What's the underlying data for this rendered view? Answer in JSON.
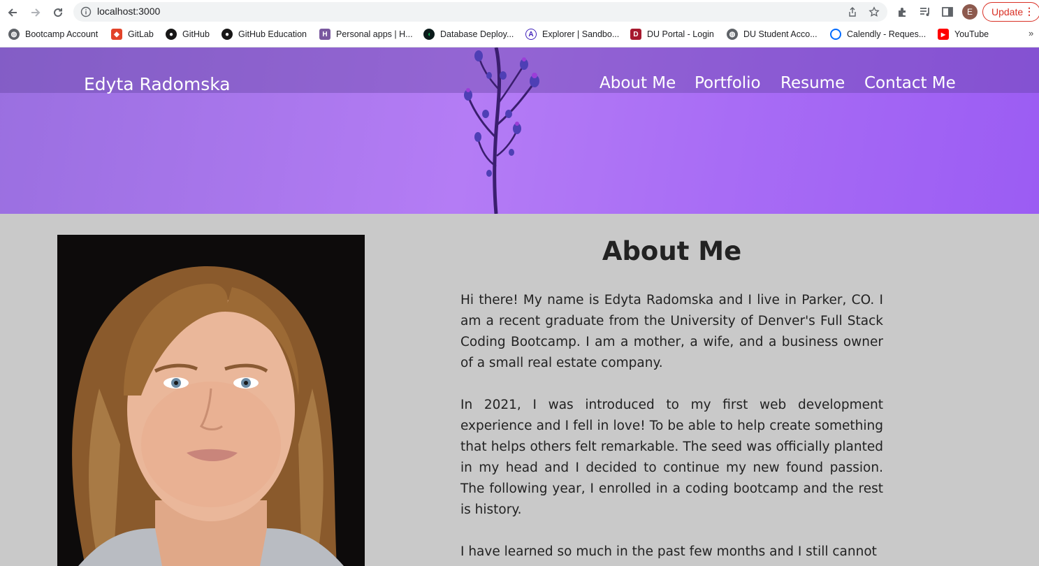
{
  "browser": {
    "url": "localhost:3000",
    "avatar_letter": "E",
    "update_label": "Update",
    "menu_glyph": "⋮",
    "more_glyph": "»",
    "bookmarks": [
      {
        "label": "Bootcamp Account",
        "icon": "globe-icon",
        "color": "#5f6368"
      },
      {
        "label": "GitLab",
        "icon": "gitlab-icon",
        "color": "#e24329"
      },
      {
        "label": "GitHub",
        "icon": "github-icon",
        "color": "#181717"
      },
      {
        "label": "GitHub Education",
        "icon": "github-icon",
        "color": "#181717"
      },
      {
        "label": "Personal apps | H...",
        "icon": "heroku-icon",
        "color": "#79589f"
      },
      {
        "label": "Database Deploy...",
        "icon": "mongodb-icon",
        "color": "#13aa52"
      },
      {
        "label": "Explorer | Sandbo...",
        "icon": "apollo-icon",
        "color": "#3f20ba"
      },
      {
        "label": "DU Portal - Login",
        "icon": "du-icon",
        "color": "#a6192e"
      },
      {
        "label": "DU Student Acco...",
        "icon": "globe-icon",
        "color": "#5f6368"
      },
      {
        "label": "Calendly - Reques...",
        "icon": "calendly-icon",
        "color": "#006bff"
      },
      {
        "label": "YouTube",
        "icon": "youtube-icon",
        "color": "#ff0000"
      }
    ]
  },
  "site": {
    "brand": "Edyta Radomska",
    "nav": [
      "About Me",
      "Portfolio",
      "Resume",
      "Contact Me"
    ]
  },
  "about": {
    "title": "About Me",
    "paragraphs": [
      "Hi there! My name is Edyta Radomska and I live in Parker, CO. I am a recent graduate from the University of Denver's Full Stack Coding Bootcamp. I am a mother, a wife, and a business owner of a small real estate company.",
      "In 2021, I was introduced to my first web development experience and I fell in love! To be able to help create something that helps others felt remarkable. The seed was officially planted in my head and I decided to continue my new found passion. The following year, I enrolled in a coding bootcamp and the rest is history.",
      "I have learned so much in the past few months and I still cannot"
    ]
  },
  "colors": {
    "hero_purple": "#b47cf5",
    "page_bg": "#c9c9c9",
    "update_red": "#d93025"
  }
}
